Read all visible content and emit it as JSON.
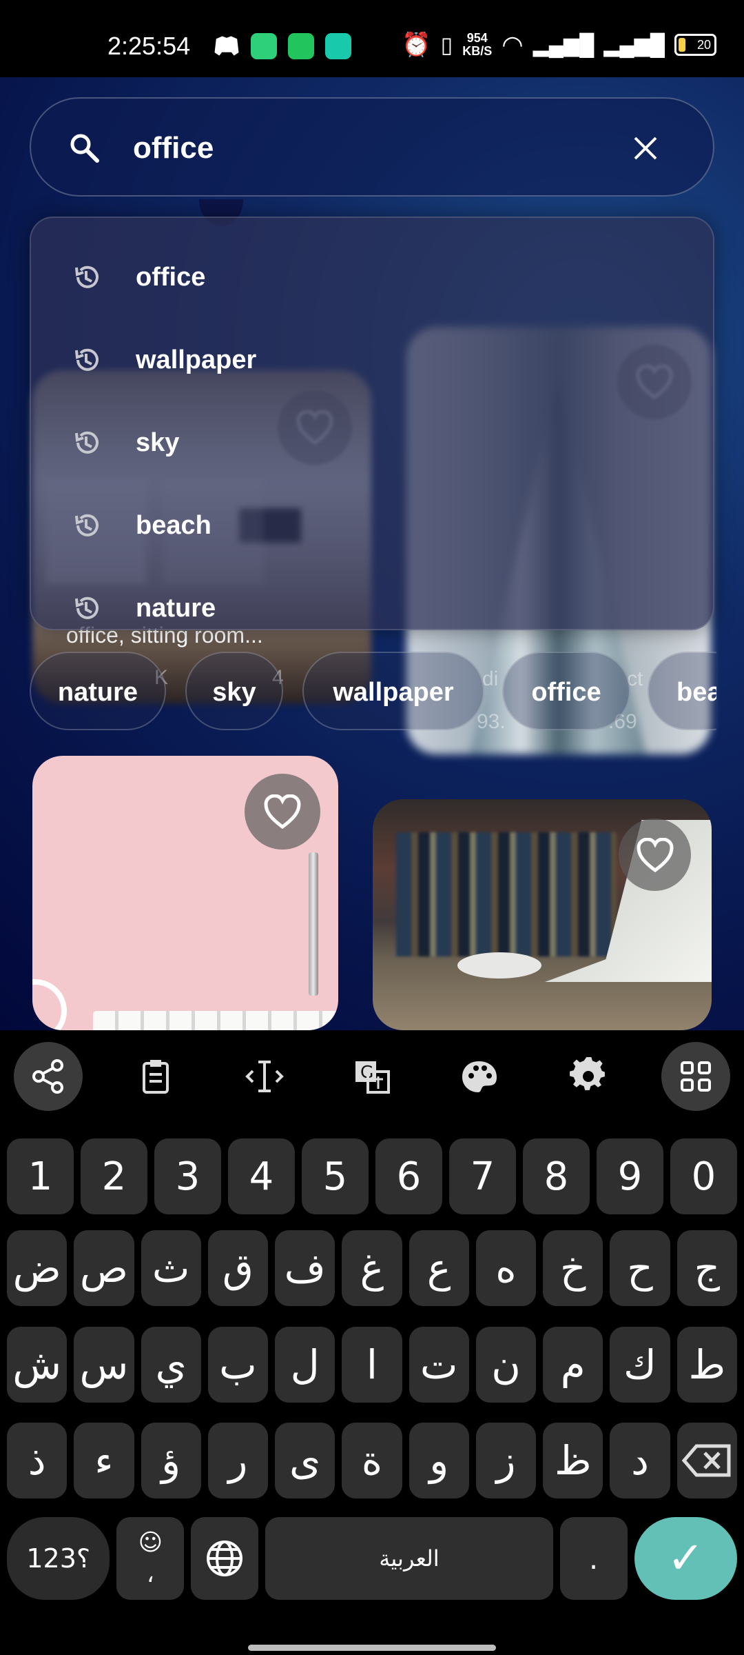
{
  "status_bar": {
    "time": "2:25:54",
    "network_speed_value": "954",
    "network_speed_unit": "KB/S",
    "battery": "20"
  },
  "search": {
    "query": "office",
    "placeholder": "Search"
  },
  "history": [
    {
      "label": "office"
    },
    {
      "label": "wallpaper"
    },
    {
      "label": "sky"
    },
    {
      "label": "beach"
    },
    {
      "label": "nature"
    }
  ],
  "chips": [
    {
      "label": "nature"
    },
    {
      "label": "sky"
    },
    {
      "label": "wallpaper"
    },
    {
      "label": "office"
    },
    {
      "label": "bea"
    }
  ],
  "cards": {
    "first_caption": "office, sitting room...",
    "meta_a": "K",
    "meta_b": "4",
    "meta_c": "93.",
    "meta_d": ".69",
    "meta_e": "di",
    "meta_f": "ct"
  },
  "keyboard": {
    "numbers": [
      "1",
      "2",
      "3",
      "4",
      "5",
      "6",
      "7",
      "8",
      "9",
      "0"
    ],
    "row_1": [
      "ض",
      "ص",
      "ث",
      "ق",
      "ف",
      "غ",
      "ع",
      "ه",
      "خ",
      "ح",
      "ج"
    ],
    "row_2": [
      "ش",
      "س",
      "ي",
      "ب",
      "ل",
      "ا",
      "ت",
      "ن",
      "م",
      "ك",
      "ط"
    ],
    "row_3": [
      "ذ",
      "ء",
      "ؤ",
      "ر",
      "ى",
      "ة",
      "و",
      "ز",
      "ظ",
      "د"
    ],
    "symbols": "؟123",
    "emoji_sub": "،",
    "space": "العربية",
    "period": ".",
    "enter": "✓"
  },
  "colors": {
    "accent": "#62c0b6",
    "dropdown": "#2c3056"
  }
}
